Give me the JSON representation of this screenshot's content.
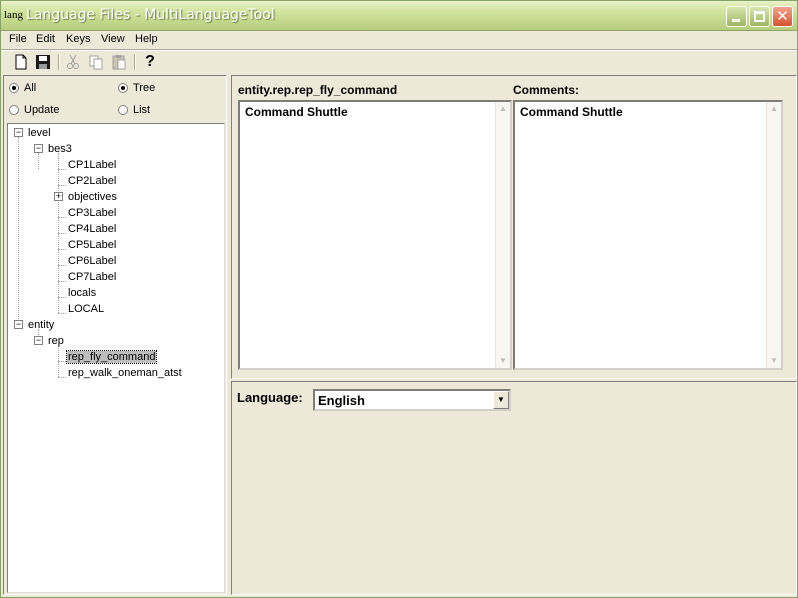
{
  "window": {
    "title": "Language Files - MultiLanguageTool",
    "app_icon_text": "lang"
  },
  "menu": {
    "items": [
      "File",
      "Edit",
      "Keys",
      "View",
      "Help"
    ]
  },
  "toolbar": {
    "icons": [
      "new-file-icon",
      "save-icon",
      "cut-icon",
      "copy-icon",
      "paste-icon",
      "help-icon"
    ],
    "help_glyph": "?"
  },
  "filters": {
    "all": "All",
    "update": "Update",
    "tree": "Tree",
    "list": "List"
  },
  "tree": {
    "level": "level",
    "bes3": "bes3",
    "cp1": "CP1Label",
    "cp2": "CP2Label",
    "objectives": "objectives",
    "cp3": "CP3Label",
    "cp4": "CP4Label",
    "cp5": "CP5Label",
    "cp6": "CP6Label",
    "cp7": "CP7Label",
    "locals": "locals",
    "local": "LOCAL",
    "entity": "entity",
    "rep": "rep",
    "rep_fly": "rep_fly_command",
    "rep_walk": "rep_walk_oneman_atst",
    "selected": "rep_fly_command"
  },
  "editor": {
    "key_label": "entity.rep.rep_fly_command",
    "value_text": "Command Shuttle",
    "comments_label": "Comments:",
    "comments_text": "Command Shuttle"
  },
  "language": {
    "label": "Language:",
    "selected": "English"
  },
  "colors": {
    "titlebar": "#c3d68b",
    "window_bg": "#ece9d8",
    "close_button": "#d6532f"
  }
}
